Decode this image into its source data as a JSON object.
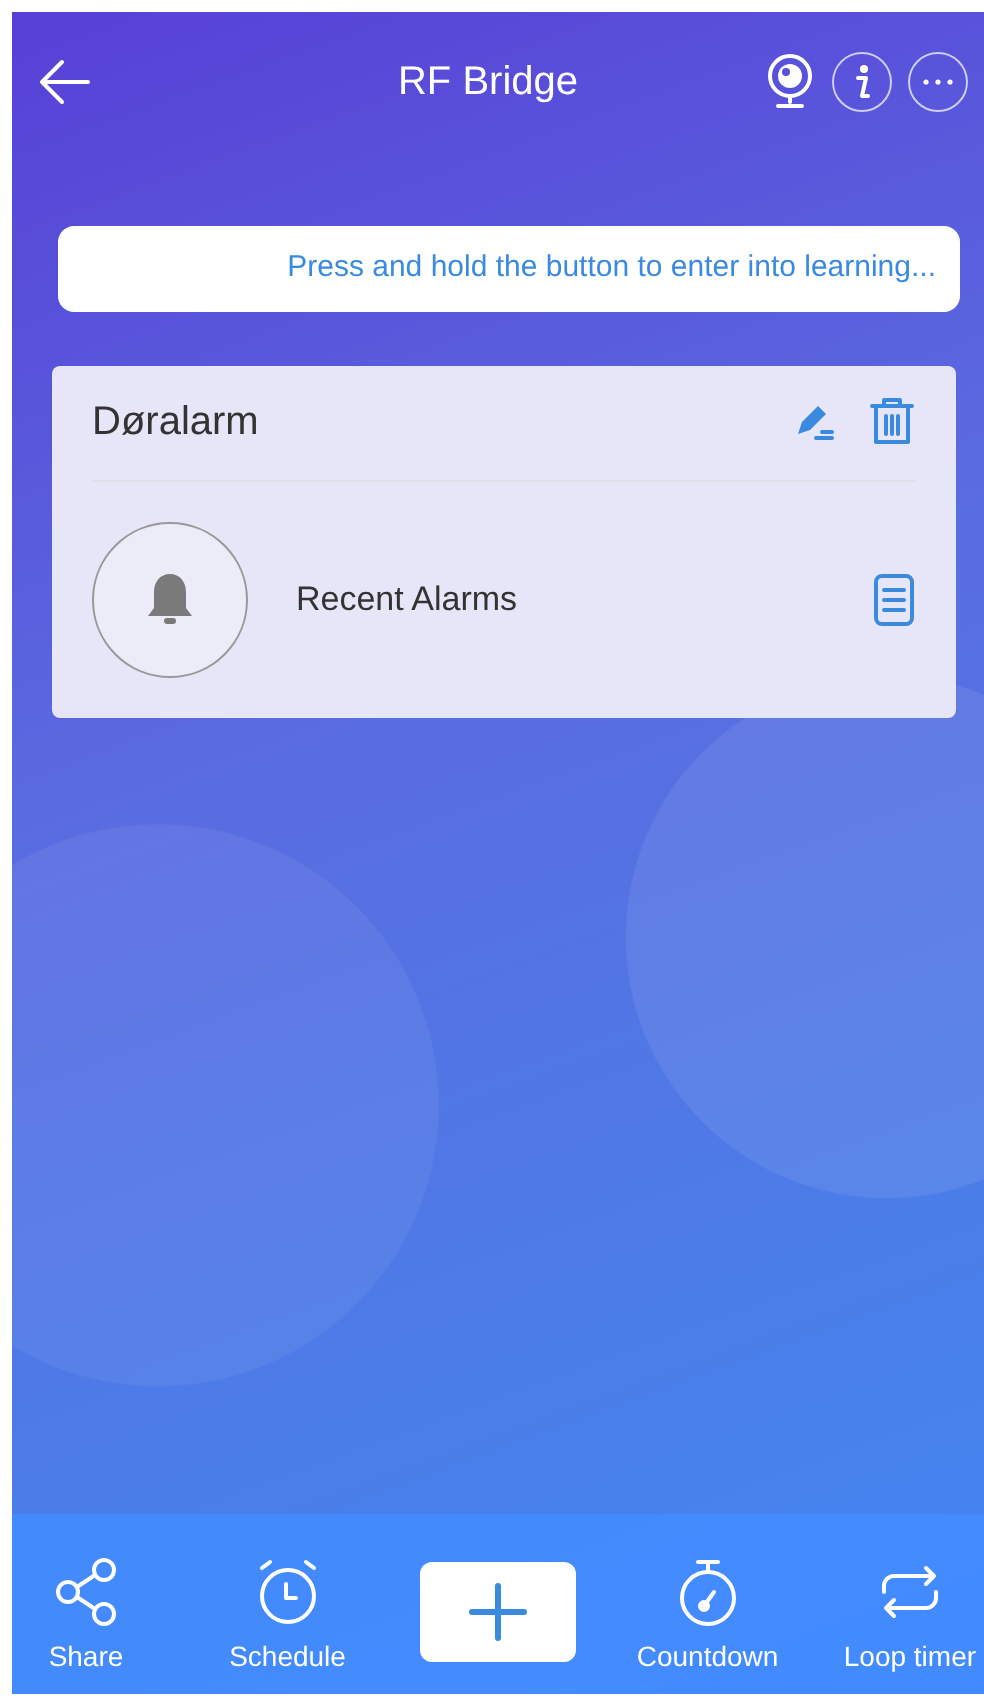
{
  "header": {
    "title": "RF Bridge"
  },
  "notice": "Press and hold the button to enter into learning...",
  "device": {
    "name": "Døralarm",
    "rows": [
      {
        "label": "Recent Alarms"
      }
    ]
  },
  "toolbar": [
    {
      "kind": "item",
      "label": "Share"
    },
    {
      "kind": "item",
      "label": "Schedule"
    },
    {
      "kind": "add"
    },
    {
      "kind": "item",
      "label": "Countdown"
    },
    {
      "kind": "item",
      "label": "Loop timer"
    }
  ]
}
